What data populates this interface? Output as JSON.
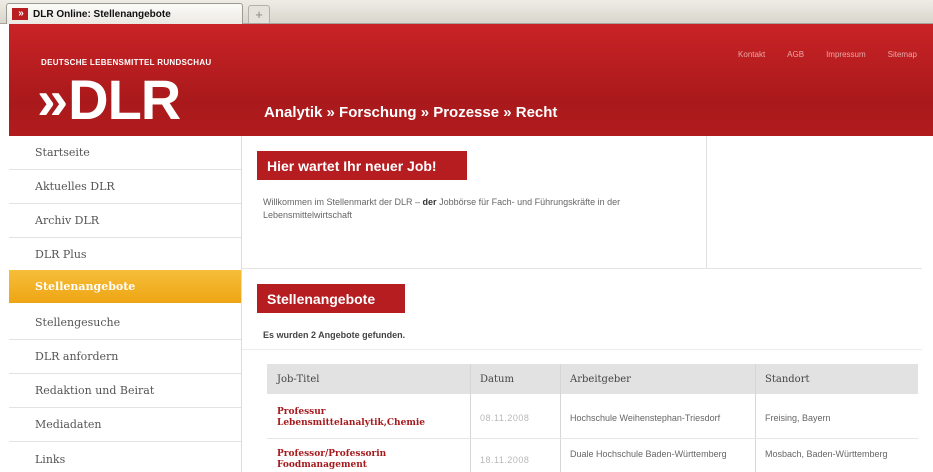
{
  "browser": {
    "tab_title": "DLR Online: Stellenangebote",
    "favicon_text": "»",
    "new_tab": "+"
  },
  "header": {
    "brand": "DEUTSCHE LEBENSMITTEL RUNDSCHAU",
    "logo_chevrons": "»",
    "logo_text": "DLR",
    "tagline": "Analytik » Forschung » Prozesse » Recht",
    "topnav": [
      "Kontakt",
      "AGB",
      "Impressum",
      "Sitemap"
    ]
  },
  "sidebar": {
    "items": [
      {
        "label": "Startseite"
      },
      {
        "label": "Aktuelles DLR"
      },
      {
        "label": "Archiv DLR"
      },
      {
        "label": "DLR Plus"
      },
      {
        "label": "Stellenangebote",
        "active": true
      },
      {
        "label": "Stellengesuche"
      },
      {
        "label": "DLR anfordern"
      },
      {
        "label": "Redaktion und Beirat"
      },
      {
        "label": "Mediadaten"
      },
      {
        "label": "Links"
      }
    ]
  },
  "welcome": {
    "title": "Hier wartet Ihr neuer Job!",
    "text_before": "Willkommen im Stellenmarkt der DLR – ",
    "text_bold": "der",
    "text_after": " Jobbörse für Fach- und Führungskräfte in der Lebensmittelwirtschaft"
  },
  "offers": {
    "title": "Stellenangebote",
    "count_text": "Es wurden 2 Angebote gefunden.",
    "columns": [
      "Job-Titel",
      "Datum",
      "Arbeitgeber",
      "Standort"
    ],
    "rows": [
      {
        "title": "Professur Lebensmittelanalytik,Chemie",
        "date": "08.11.2008",
        "employer": "Hochschule Weihenstephan-Triesdorf",
        "location": "Freising, Bayern"
      },
      {
        "title": "Professor/Professorin Foodmanagement",
        "date": "18.11.2008",
        "employer": "Duale Hochschule Baden-Württemberg",
        "location": "Mosbach, Baden-Württemberg"
      }
    ]
  },
  "colors": {
    "brand_red": "#b51d20",
    "active_orange": "#f0a91c"
  }
}
